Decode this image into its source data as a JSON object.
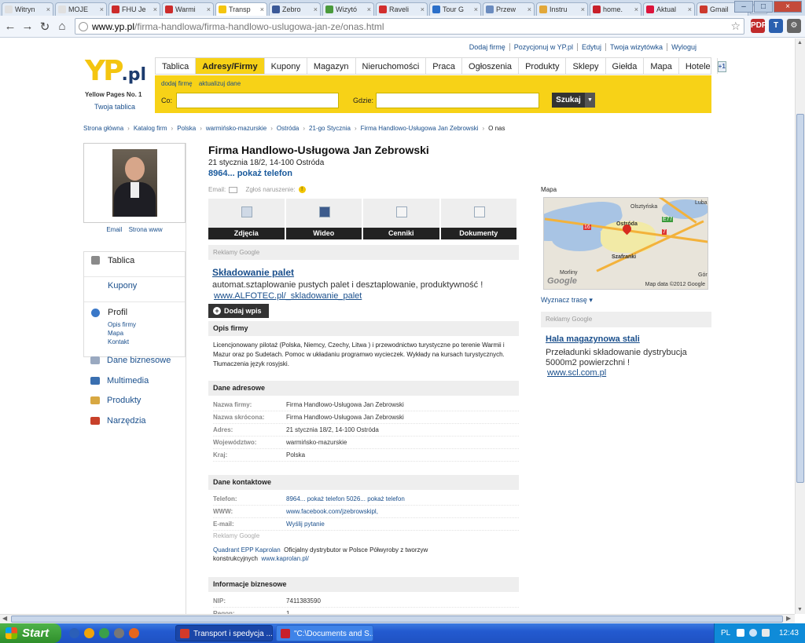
{
  "browser": {
    "tabs": [
      {
        "label": "Witryn",
        "color": "#e0e0e0",
        "active": false
      },
      {
        "label": "MOJE",
        "color": "#e0e0e0",
        "active": false
      },
      {
        "label": "FHU Je",
        "color": "#cc2b2b",
        "active": false
      },
      {
        "label": "Warmi",
        "color": "#cc2b2b",
        "active": false
      },
      {
        "label": "Transp",
        "color": "#f4c510",
        "active": true
      },
      {
        "label": "Zebro",
        "color": "#3b5998",
        "active": false
      },
      {
        "label": "Wizytó",
        "color": "#4a9a3b",
        "active": false
      },
      {
        "label": "Raveli",
        "color": "#d22e2e",
        "active": false
      },
      {
        "label": "Tour G",
        "color": "#2b6fc9",
        "active": false
      },
      {
        "label": "Przew",
        "color": "#6a8bbf",
        "active": false
      },
      {
        "label": "Instru",
        "color": "#e2a83a",
        "active": false
      },
      {
        "label": "home.",
        "color": "#c8202a",
        "active": false
      },
      {
        "label": "Aktual",
        "color": "#dc143c",
        "active": false
      },
      {
        "label": "Gmail",
        "color": "#cc3a2e",
        "active": false
      }
    ],
    "tab_close": "×",
    "window_buttons": {
      "minimize": "–",
      "maximize": "□",
      "close": "×"
    },
    "nav": {
      "back": "←",
      "forward": "→",
      "reload": "↻",
      "home": "⌂"
    },
    "url_host": "www.yp.pl",
    "url_path": "/firma-handlowa/firma-handlowo-uslugowa-jan-ze/onas.html",
    "bookmark_star": "☆",
    "extensions": [
      {
        "label": "PDF",
        "color": "#c02a2a"
      },
      {
        "label": "T",
        "color": "#2a60b0"
      },
      {
        "label": "⚙",
        "color": "#666666"
      }
    ]
  },
  "site": {
    "top_links": [
      "Dodaj firmę",
      "Pozycjonuj w YP.pl",
      "Edytuj",
      "Twoja wizytówka",
      "Wyloguj"
    ],
    "logo_main": "YP",
    "logo_suffix": ".pl",
    "logo_sub": "Yellow Pages No. 1",
    "logo_link": "Twoja tablica",
    "nav": [
      "Tablica",
      "Adresy/Firmy",
      "Kupony",
      "Magazyn",
      "Nieruchomości",
      "Praca",
      "Ogłoszenia",
      "Produkty",
      "Sklepy",
      "Giełda",
      "Mapa",
      "Hotele"
    ],
    "nav_active": "Adresy/Firmy",
    "gplus": "+1",
    "search_sublinks": [
      "dodaj firmę",
      "aktualizuj dane"
    ],
    "search_co_label": "Co:",
    "search_co_value": "",
    "search_gdzie_label": "Gdzie:",
    "search_gdzie_value": "",
    "search_button": "Szukaj",
    "search_dropdown": "▼"
  },
  "breadcrumb": {
    "items": [
      "Strona główna",
      "Katalog firm",
      "Polska",
      "warmińsko-mazurskie",
      "Ostróda",
      "21-go Stycznia",
      "Firma Handlowo-Usługowa Jan Zebrowski",
      "O nas"
    ],
    "separator": "›"
  },
  "left": {
    "photo_links": [
      "Email",
      "Strona www"
    ],
    "menu": [
      {
        "label": "Tablica",
        "color": "#8a8a8a"
      },
      {
        "label": "Kupony",
        "color": ""
      }
    ],
    "profil": {
      "label": "Profil",
      "color": "#3a78c8",
      "subs": [
        "Opis firmy",
        "Mapa",
        "Kontakt"
      ]
    },
    "menu2": [
      {
        "label": "Dane biznesowe",
        "color": "#9aa9c0"
      },
      {
        "label": "Multimedia",
        "color": "#3a6fb0"
      },
      {
        "label": "Produkty",
        "color": "#d8a842"
      },
      {
        "label": "Narzędzia",
        "color": "#c8402a"
      }
    ]
  },
  "company": {
    "name": "Firma Handlowo-Usługowa Jan Zebrowski",
    "address": "21 stycznia 18/2, 14-100 Ostróda",
    "phone": "8964... pokaż telefon",
    "email_label": "Email:",
    "report_label": "Zgłoś naruszenie:",
    "report_icon": "!"
  },
  "media_tabs": [
    "Zdjęcia",
    "Wideo",
    "Cenniki",
    "Dokumenty"
  ],
  "ads_label": "Reklamy Google",
  "ad1": {
    "title": "Składowanie palet",
    "text": "automat.sztaplowanie pustych palet i desztaplowanie, produktywność !",
    "url": "www.ALFOTEC.pl/_skladowanie_palet"
  },
  "dodaj_wpis": "Dodaj wpis",
  "dodaj_plus": "+",
  "opis": {
    "header": "Opis firmy",
    "text": "Licencjonowany pilotaż (Polska, Niemcy, Czechy, Litwa ) i przewodnictwo turystyczne po terenie Warmii i Mazur oraz po Sudetach. Pomoc w układaniu programwo wycieczek. Wykłady na kursach turystycznych. Tłumaczenia język rosyjski."
  },
  "dane_adresowe": {
    "header": "Dane adresowe",
    "rows": [
      {
        "k": "Nazwa firmy:",
        "v": "Firma Handlowo-Usługowa Jan Zebrowski"
      },
      {
        "k": "Nazwa skrócona:",
        "v": "Firma Handlowo-Usługowa Jan Zebrowski"
      },
      {
        "k": "Adres:",
        "v": "21 stycznia 18/2, 14-100 Ostróda"
      },
      {
        "k": "Województwo:",
        "v": "warmińsko-mazurskie"
      },
      {
        "k": "Kraj:",
        "v": "Polska"
      }
    ]
  },
  "dane_kontaktowe": {
    "header": "Dane kontaktowe",
    "rows": [
      {
        "k": "Telefon:",
        "v": "8964... pokaż telefon 5026... pokaż telefon"
      },
      {
        "k": "WWW:",
        "v": "www.facebook.com/jzebrowskipl,"
      },
      {
        "k": "E-mail:",
        "v": "Wyślij pytanie"
      }
    ],
    "ad_label": "Reklamy Google",
    "ad_quadrant_link": "Quadrant EPP Kaprolan",
    "ad_quadrant_text": "Oficjalny dystrybutor w Polsce Półwyroby z tworzyw konstrukcyjnych",
    "ad_quadrant_url": "www.kaprolan.pl/"
  },
  "informacje": {
    "header": "Informacje biznesowe",
    "rows": [
      {
        "k": "NIP:",
        "v": "7411383590"
      },
      {
        "k": "Regon:",
        "v": "1..."
      }
    ]
  },
  "right": {
    "map_label": "Mapa",
    "map_places": [
      "Ostróda",
      "Szafranki",
      "Morliny",
      "Luba",
      "Olsztyńska",
      "Gór"
    ],
    "map_roads": [
      "16",
      "E77",
      "7"
    ],
    "map_google": "Google",
    "map_data": "Map data ©2012 Google",
    "route": "Wyznacz trasę ▾",
    "ads_label": "Reklamy Google",
    "ad2_title": "Hala magazynowa stali",
    "ad2_text": "Przeładunki składowanie dystrybucja 5000m2 powierzchni !",
    "ad2_url": "www.scl.com.pl"
  },
  "taskbar": {
    "start": "Start",
    "quick_icons": [
      "#2b5fb8",
      "#f0a30a",
      "#3aa04a",
      "#777777",
      "#e8661c"
    ],
    "buttons": [
      {
        "label": "Transport i spedycja ...",
        "color": "#d23a2a"
      },
      {
        "label": "\"C:\\Documents and S...",
        "color": "#c8202a"
      }
    ],
    "lang": "PL",
    "clock": "12:43"
  }
}
